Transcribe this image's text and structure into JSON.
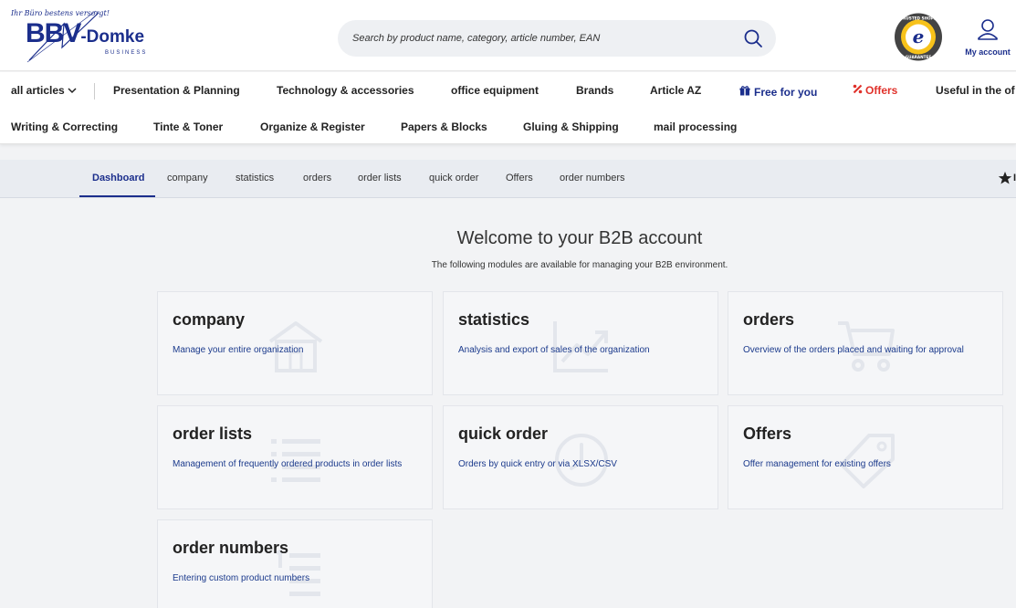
{
  "header": {
    "logo": {
      "tagline": "Ihr Büro bestens versorgt!",
      "brand_main": "BBV",
      "brand_suffix": "-Domke",
      "brand_sub": "BUSINESS"
    },
    "search": {
      "placeholder": "Search by product name, category, article number, EAN"
    },
    "trusted_badge": "trusted shops guarantee",
    "account_label": "My account"
  },
  "nav": {
    "row1": [
      {
        "label": "all articles"
      },
      {
        "label": "Presentation & Planning"
      },
      {
        "label": "Technology & accessories"
      },
      {
        "label": "office equipment"
      },
      {
        "label": "Brands"
      },
      {
        "label": "Article AZ"
      },
      {
        "label": "Free for you"
      },
      {
        "label": "Offers"
      },
      {
        "label": "Useful in the of"
      }
    ],
    "row2": [
      {
        "label": "Writing & Correcting"
      },
      {
        "label": "Tinte & Toner"
      },
      {
        "label": "Organize & Register"
      },
      {
        "label": "Papers & Blocks"
      },
      {
        "label": "Gluing & Shipping"
      },
      {
        "label": "mail processing"
      }
    ]
  },
  "subnav": {
    "tabs": [
      {
        "label": "Dashboard"
      },
      {
        "label": "company"
      },
      {
        "label": "statistics"
      },
      {
        "label": "orders"
      },
      {
        "label": "order lists"
      },
      {
        "label": "quick order"
      },
      {
        "label": "Offers"
      },
      {
        "label": "order numbers"
      }
    ],
    "active_tab": "Dashboard",
    "cut_label": "I"
  },
  "main": {
    "title": "Welcome to your B2B account",
    "subtitle": "The following modules are available for managing your B2B environment.",
    "cards": [
      {
        "title": "company",
        "desc": "Manage your entire organization",
        "icon": "building-icon"
      },
      {
        "title": "statistics",
        "desc": "Analysis and export of sales of the organization",
        "icon": "chart-icon"
      },
      {
        "title": "orders",
        "desc": "Overview of the orders placed and waiting for approval",
        "icon": "cart-icon"
      },
      {
        "title": "order lists",
        "desc": "Management of frequently ordered products in order lists",
        "icon": "list-icon"
      },
      {
        "title": "quick order",
        "desc": "Orders by quick entry or via XLSX/CSV",
        "icon": "clock-icon"
      },
      {
        "title": "Offers",
        "desc": "Offer management for existing offers",
        "icon": "tag-icon"
      },
      {
        "title": "order numbers",
        "desc": "Entering custom product numbers",
        "icon": "numbered-list-icon"
      }
    ]
  },
  "colors": {
    "brand_blue": "#1b2e8c",
    "offers_red": "#e0312a",
    "background": "#f2f3f5"
  }
}
